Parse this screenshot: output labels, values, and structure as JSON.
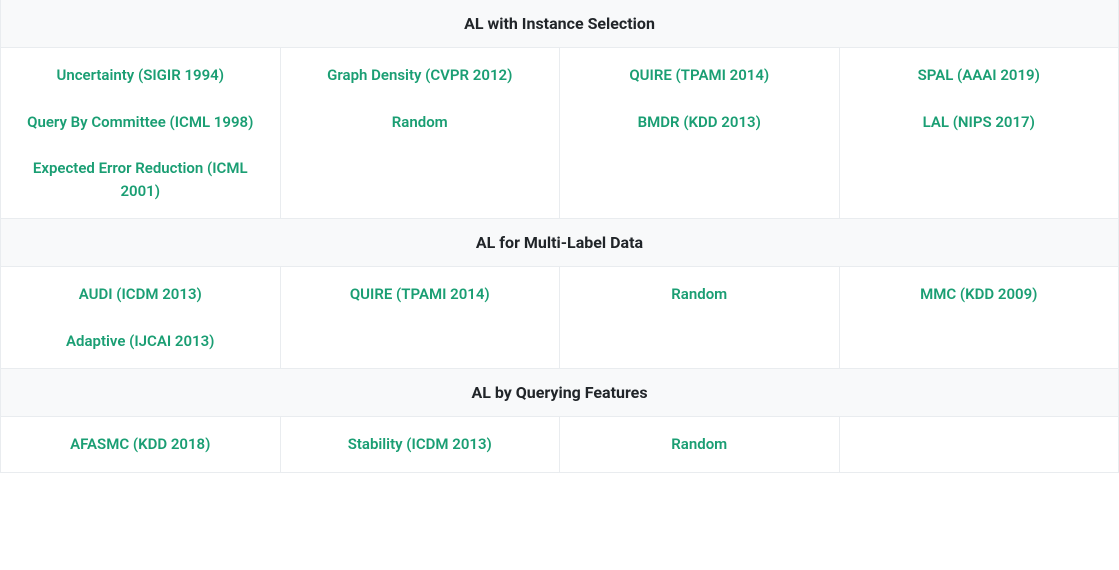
{
  "sections": [
    {
      "title": "AL with Instance Selection",
      "columns": [
        [
          "Uncertainty (SIGIR 1994)",
          "Query By Committee (ICML 1998)",
          "Expected Error Reduction (ICML 2001)"
        ],
        [
          "Graph Density (CVPR 2012)",
          "Random"
        ],
        [
          "QUIRE (TPAMI 2014)",
          "BMDR (KDD 2013)"
        ],
        [
          "SPAL (AAAI 2019)",
          "LAL (NIPS 2017)"
        ]
      ]
    },
    {
      "title": "AL for Multi-Label Data",
      "columns": [
        [
          "AUDI (ICDM 2013)",
          "Adaptive (IJCAI 2013)"
        ],
        [
          "QUIRE (TPAMI 2014)"
        ],
        [
          "Random"
        ],
        [
          "MMC (KDD 2009)"
        ]
      ]
    },
    {
      "title": "AL by Querying Features",
      "columns": [
        [
          "AFASMC (KDD 2018)"
        ],
        [
          "Stability (ICDM 2013)"
        ],
        [
          "Random"
        ],
        []
      ]
    }
  ]
}
